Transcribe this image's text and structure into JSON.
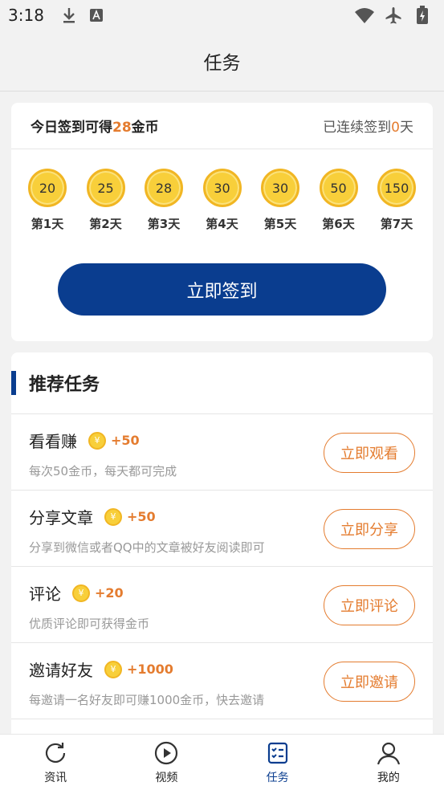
{
  "status_bar": {
    "time": "3:18",
    "icons": [
      "download-icon",
      "a-badge-icon",
      "wifi-icon",
      "airplane-icon",
      "battery-icon"
    ]
  },
  "header": {
    "title": "任务"
  },
  "signin": {
    "prefix": "今日签到可得",
    "coins_today": "28",
    "suffix": "金币",
    "streak_prefix": "已连续签到",
    "streak_days": "0",
    "streak_suffix": "天",
    "days": [
      {
        "coins": "20",
        "label": "第1天"
      },
      {
        "coins": "25",
        "label": "第2天"
      },
      {
        "coins": "28",
        "label": "第3天"
      },
      {
        "coins": "30",
        "label": "第4天"
      },
      {
        "coins": "30",
        "label": "第5天"
      },
      {
        "coins": "50",
        "label": "第6天"
      },
      {
        "coins": "150",
        "label": "第7天"
      }
    ],
    "button_label": "立即签到"
  },
  "tasks": {
    "title": "推荐任务",
    "coin_symbol": "¥",
    "items": [
      {
        "name": "看看赚",
        "reward": "+50",
        "desc": "每次50金币，每天都可完成",
        "button": "立即观看"
      },
      {
        "name": "分享文章",
        "reward": "+50",
        "desc": "分享到微信或者QQ中的文章被好友阅读即可",
        "button": "立即分享"
      },
      {
        "name": "评论",
        "reward": "+20",
        "desc": "优质评论即可获得金币",
        "button": "立即评论"
      },
      {
        "name": "邀请好友",
        "reward": "+1000",
        "desc": "每邀请一名好友即可赚1000金币，快去邀请",
        "button": "立即邀请"
      }
    ]
  },
  "bottom_nav": {
    "items": [
      {
        "label": "资讯",
        "icon": "refresh-icon",
        "active": false
      },
      {
        "label": "视频",
        "icon": "play-circle-icon",
        "active": false
      },
      {
        "label": "任务",
        "icon": "task-list-icon",
        "active": true
      },
      {
        "label": "我的",
        "icon": "person-icon",
        "active": false
      }
    ]
  },
  "colors": {
    "primary": "#0a3d8f",
    "accent": "#e47c2f",
    "coin": "#f8cf3a"
  }
}
